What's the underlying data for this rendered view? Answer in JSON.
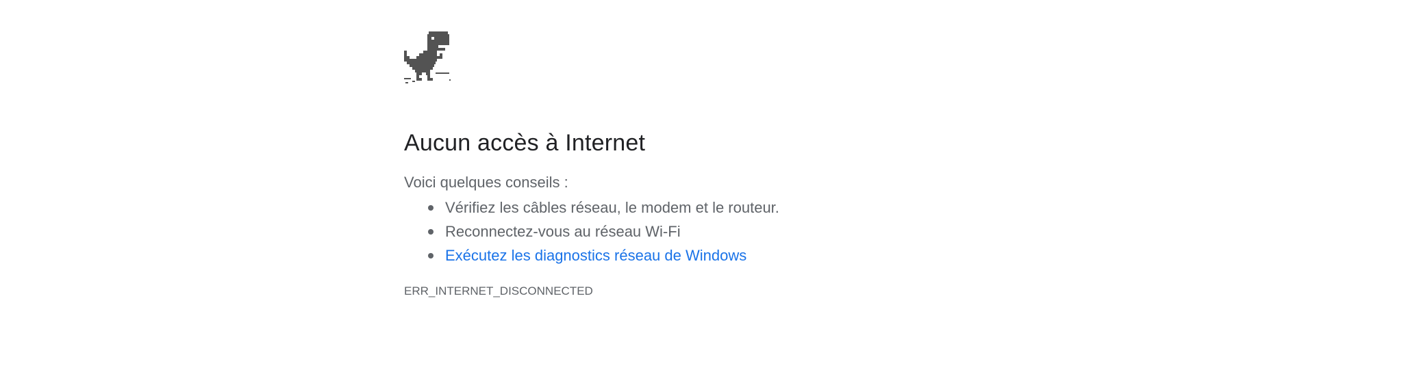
{
  "page": {
    "title": "Aucun accès à Internet",
    "intro": "Voici quelques conseils :",
    "tips": [
      {
        "label": "Vérifiez les câbles réseau, le modem et le routeur."
      },
      {
        "label": "Reconnectez-vous au réseau Wi-Fi"
      },
      {
        "label": "Exécutez les diagnostics réseau de Windows",
        "is_link": true
      }
    ],
    "error_code": "ERR_INTERNET_DISCONNECTED"
  },
  "icons": {
    "main_icon": "offline-dino-icon"
  },
  "colors": {
    "title": "#202124",
    "body_text": "#5f6368",
    "link": "#1a73e8",
    "dino": "#535353",
    "background": "#ffffff"
  }
}
